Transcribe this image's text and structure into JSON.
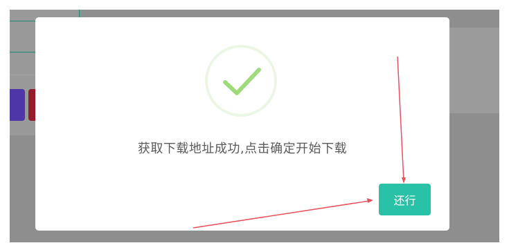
{
  "dialog": {
    "message": "获取下载地址成功,点击确定开始下载",
    "confirm_label": "还行",
    "icon": "checkmark-success-icon"
  },
  "colors": {
    "accent": "#2ac2a6",
    "check": "#9fdb7d",
    "overlay": "#8e8e8e",
    "annotation_arrow": "#e8505b"
  }
}
